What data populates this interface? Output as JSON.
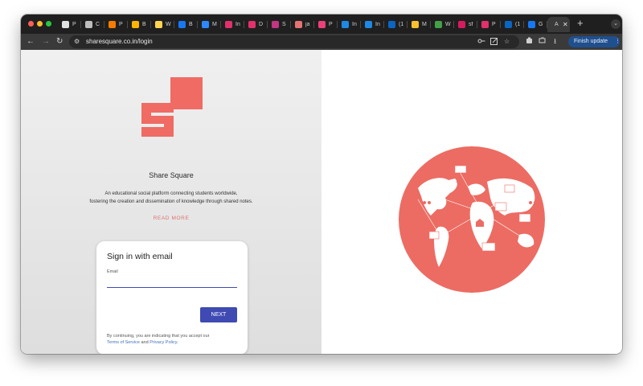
{
  "browser": {
    "tabs": [
      {
        "label": "P",
        "icon": "stack-icon",
        "color": "#e0e0e0"
      },
      {
        "label": "C",
        "icon": "settings-icon",
        "color": "#bdbdbd"
      },
      {
        "label": "P",
        "icon": "flame-icon",
        "color": "#f57c00"
      },
      {
        "label": "B",
        "icon": "arrow-icon",
        "color": "#ffb300"
      },
      {
        "label": "W",
        "icon": "workspace-icon",
        "color": "#ffd54f"
      },
      {
        "label": "B",
        "icon": "facebook-icon",
        "color": "#1877f2"
      },
      {
        "label": "M",
        "icon": "meta-icon",
        "color": "#2d88ff"
      },
      {
        "label": "In",
        "icon": "instagram-icon",
        "color": "#e1306c"
      },
      {
        "label": "D",
        "icon": "instagram-icon",
        "color": "#e1306c"
      },
      {
        "label": "S",
        "icon": "instagram-icon",
        "color": "#c13584"
      },
      {
        "label": "ja",
        "icon": "circle-icon",
        "color": "#e57373"
      },
      {
        "label": "P",
        "icon": "dot-icon",
        "color": "#ec407a"
      },
      {
        "label": "In",
        "icon": "square-icon",
        "color": "#1e88e5"
      },
      {
        "label": "In",
        "icon": "square-icon",
        "color": "#1e88e5"
      },
      {
        "label": "(1",
        "icon": "linkedin-icon",
        "color": "#0a66c2"
      },
      {
        "label": "M",
        "icon": "chart-icon",
        "color": "#fbc02d"
      },
      {
        "label": "W",
        "icon": "pin-icon",
        "color": "#43a047"
      },
      {
        "label": "sf",
        "icon": "dot-icon",
        "color": "#d81b60"
      },
      {
        "label": "P",
        "icon": "instagram-icon",
        "color": "#e1306c"
      },
      {
        "label": "(1",
        "icon": "linkedin-icon",
        "color": "#0a66c2"
      },
      {
        "label": "G",
        "icon": "facebook-icon",
        "color": "#1877f2"
      }
    ],
    "active_tab": {
      "label": "A",
      "close": "✕"
    },
    "new_tab": "+",
    "tab_menu": "⌄",
    "back": "←",
    "forward": "→",
    "reload": "↻",
    "site_info": "⚙",
    "url": "sharesquare.co.in/login",
    "finish_update": "Finish update",
    "finish_update_menu": "⋮"
  },
  "page": {
    "brand": "Share Square",
    "tagline_line1": "An educational social platform connecting students worldwide,",
    "tagline_line2": "fostering the creation and dissemination of knowledge through shared notes.",
    "read_more": "READ MORE",
    "logo_color": "#ef6b64"
  },
  "signin": {
    "title": "Sign in with email",
    "email_label": "Email",
    "email_value": "",
    "next": "NEXT",
    "consent_prefix": "By continuing, you are indicating that you accept our",
    "terms": "Terms of Service",
    "and": "and",
    "privacy": "Privacy Policy",
    "period": "."
  },
  "colors": {
    "accent": "#3f4ab2",
    "brand_red": "#ef6b64",
    "link": "#3f6fc2"
  }
}
